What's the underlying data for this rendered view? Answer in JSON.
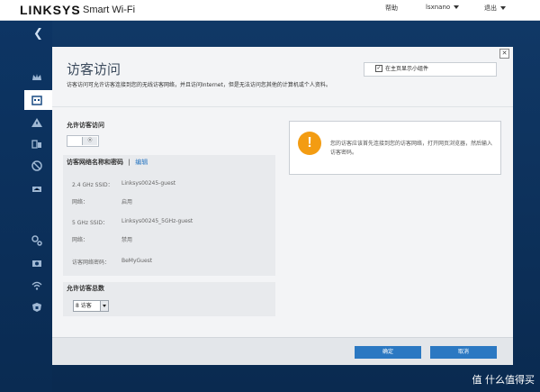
{
  "header": {
    "brand": "LINKSYS",
    "product": "Smart Wi-Fi",
    "help": "帮助",
    "user": "lsxnano",
    "logout": "退出"
  },
  "dialog": {
    "title": "访客访问",
    "description": "访客访问可允许访客连接到您的无线访客网络，并且访问Internet，但是无法访问您其他的计算机或个人资料。",
    "show_widget_label": "在主页显示小组件",
    "allow_guest_label": "允许访客访问",
    "network_section_title": "访客网络名称和密码",
    "edit_link": "编辑",
    "ssid24_label": "2.4 GHz SSID：",
    "ssid24_value": "Linksys00245-guest",
    "network24_label": "网络：",
    "network24_value": "启用",
    "ssid5_label": "5 GHz SSID：",
    "ssid5_value": "Linksys00245_5GHz-guest",
    "network5_label": "网络：",
    "network5_value": "禁用",
    "password_label": "访客网络密码：",
    "password_value": "BeMyGuest",
    "total_guests_label": "允许访客总数",
    "total_guests_value": "8 访客",
    "notice_text": "您的访客应该首先连接到您的访客网络，打开网页浏览器，然后输入访客密码。",
    "ok_button": "确定",
    "cancel_button": "取消"
  },
  "watermark": "值 什么值得买",
  "colors": {
    "accent": "#2b78c2",
    "warning": "#f39c12",
    "sidebar": "#0d3564"
  }
}
